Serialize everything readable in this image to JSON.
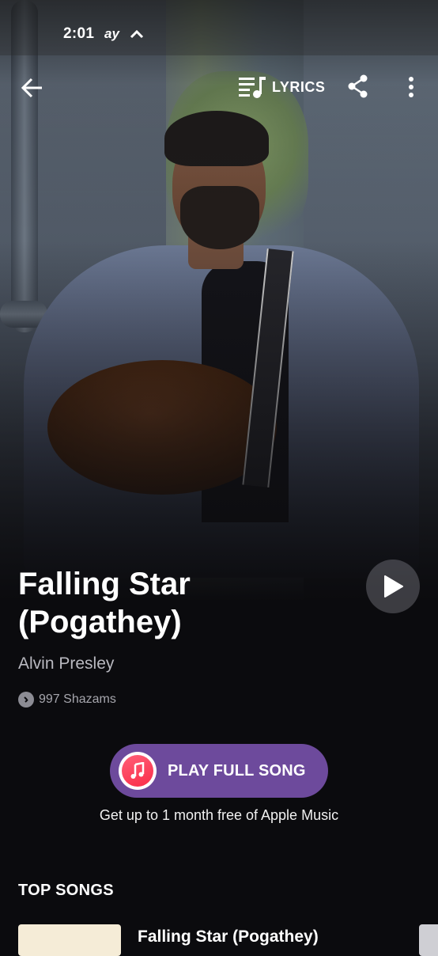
{
  "status_bar": {
    "time": "2:01",
    "icons": [
      "airtel-icon",
      "chevron-up-icon"
    ]
  },
  "toolbar": {
    "lyrics_label": "LYRICS",
    "icons": [
      "back-arrow-icon",
      "lyrics-icon",
      "share-icon",
      "more-vert-icon"
    ]
  },
  "song": {
    "title": "Falling Star (Pogathey)",
    "artist": "Alvin Presley",
    "shazam_count": "997 Shazams"
  },
  "cta": {
    "play_full_song": "PLAY FULL SONG",
    "promo": "Get up to 1 month free of Apple Music",
    "button_color": "#6d4a9c",
    "apple_music_color": "#fa2d48"
  },
  "top_songs": {
    "heading": "TOP SONGS",
    "items": [
      {
        "title": "Falling Star (Pogathey)"
      }
    ]
  }
}
